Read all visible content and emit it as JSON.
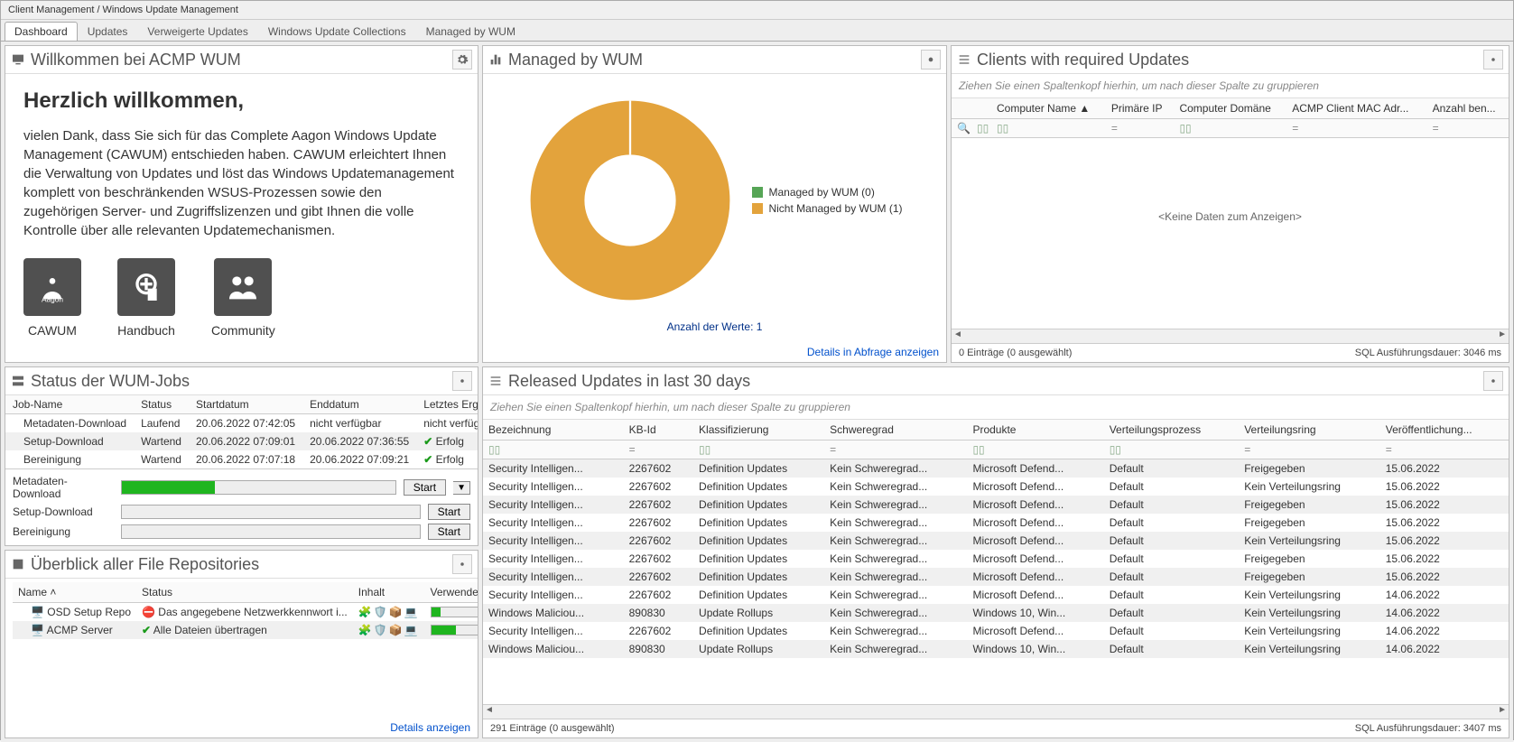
{
  "breadcrumb": "Client Management / Windows Update Management",
  "tabs": [
    "Dashboard",
    "Updates",
    "Verweigerte Updates",
    "Windows Update Collections",
    "Managed by WUM"
  ],
  "active_tab": 0,
  "welcome": {
    "panel_title": "Willkommen bei ACMP WUM",
    "heading": "Herzlich willkommen,",
    "paragraph": "vielen Dank, dass Sie sich für das Complete Aagon Windows Update Management (CAWUM) entschieden haben. CAWUM erleichtert Ihnen die Verwaltung von Updates und löst das Windows Updatemanagement komplett von beschränkenden WSUS-Prozessen sowie den zugehörigen Server- und Zugriffslizenzen und gibt Ihnen die volle Kontrolle über alle relevanten Updatemechanismen.",
    "cards": [
      {
        "label": "CAWUM",
        "icon": "package-icon"
      },
      {
        "label": "Handbuch",
        "icon": "book-icon"
      },
      {
        "label": "Community",
        "icon": "people-icon"
      }
    ]
  },
  "managed": {
    "panel_title": "Managed by WUM",
    "legend": [
      {
        "color": "#56a556",
        "label": "Managed by WUM (0)",
        "value": 0
      },
      {
        "color": "#e3a33c",
        "label": "Nicht Managed by WUM (1)",
        "value": 1
      }
    ],
    "caption": "Anzahl der Werte: 1",
    "details_link": "Details in Abfrage anzeigen"
  },
  "chart_data": {
    "type": "pie",
    "title": "Managed by WUM",
    "categories": [
      "Managed by WUM",
      "Nicht Managed by WUM"
    ],
    "values": [
      0,
      1
    ],
    "colors": [
      "#56a556",
      "#e3a33c"
    ]
  },
  "clients": {
    "panel_title": "Clients with required Updates",
    "group_hint": "Ziehen Sie einen Spaltenkopf hierhin, um nach dieser Spalte zu gruppieren",
    "columns": [
      "",
      "",
      "Computer Name ▲",
      "Primäre IP",
      "Computer Domäne",
      "ACMP Client MAC Adr...",
      "Anzahl ben..."
    ],
    "nodata": "<Keine Daten zum Anzeigen>",
    "status_left": "0 Einträge (0 ausgewählt)",
    "status_right": "SQL Ausführungsdauer: 3046 ms"
  },
  "jobs": {
    "panel_title": "Status der WUM-Jobs",
    "columns": [
      "Job-Name",
      "Status",
      "Startdatum",
      "Enddatum",
      "Letztes Ergebnis"
    ],
    "rows": [
      {
        "name": "Metadaten-Download",
        "status": "Laufend",
        "start": "20.06.2022 07:42:05",
        "end": "nicht verfügbar",
        "result": "nicht verfügbar",
        "ok": false
      },
      {
        "name": "Setup-Download",
        "status": "Wartend",
        "start": "20.06.2022 07:09:01",
        "end": "20.06.2022 07:36:55",
        "result": "Erfolg",
        "ok": true
      },
      {
        "name": "Bereinigung",
        "status": "Wartend",
        "start": "20.06.2022 07:07:18",
        "end": "20.06.2022 07:09:21",
        "result": "Erfolg",
        "ok": true
      }
    ],
    "progress": [
      {
        "label": "Metadaten-Download",
        "pct": 34,
        "start": "Start",
        "dropdown": true
      },
      {
        "label": "Setup-Download",
        "pct": 0,
        "start": "Start"
      },
      {
        "label": "Bereinigung",
        "pct": 0,
        "start": "Start"
      }
    ]
  },
  "repos": {
    "panel_title": "Überblick aller File Repositories",
    "columns": [
      "Name ˄",
      "Status",
      "Inhalt",
      "Verwendeter Speicher"
    ],
    "rows": [
      {
        "name": "OSD Setup Repo",
        "status": "Das angegebene Netzwerkkennwort i...",
        "status_icon": "error",
        "storage_pct": 10
      },
      {
        "name": "ACMP Server",
        "status": "Alle Dateien übertragen",
        "status_icon": "ok",
        "storage_pct": 25
      }
    ],
    "details_link": "Details anzeigen"
  },
  "released": {
    "panel_title": "Released Updates in last 30 days",
    "group_hint": "Ziehen Sie einen Spaltenkopf hierhin, um nach dieser Spalte zu gruppieren",
    "columns": [
      "Bezeichnung",
      "KB-Id",
      "Klassifizierung",
      "Schweregrad",
      "Produkte",
      "Verteilungsprozess",
      "Verteilungsring",
      "Veröffentlichung..."
    ],
    "rows": [
      {
        "c": [
          "Security Intelligen...",
          "2267602",
          "Definition Updates",
          "Kein Schweregrad...",
          "Microsoft Defend...",
          "Default",
          "Freigegeben",
          "15.06.2022"
        ]
      },
      {
        "c": [
          "Security Intelligen...",
          "2267602",
          "Definition Updates",
          "Kein Schweregrad...",
          "Microsoft Defend...",
          "Default",
          "Kein Verteilungsring",
          "15.06.2022"
        ]
      },
      {
        "c": [
          "Security Intelligen...",
          "2267602",
          "Definition Updates",
          "Kein Schweregrad...",
          "Microsoft Defend...",
          "Default",
          "Freigegeben",
          "15.06.2022"
        ]
      },
      {
        "c": [
          "Security Intelligen...",
          "2267602",
          "Definition Updates",
          "Kein Schweregrad...",
          "Microsoft Defend...",
          "Default",
          "Freigegeben",
          "15.06.2022"
        ]
      },
      {
        "c": [
          "Security Intelligen...",
          "2267602",
          "Definition Updates",
          "Kein Schweregrad...",
          "Microsoft Defend...",
          "Default",
          "Kein Verteilungsring",
          "15.06.2022"
        ]
      },
      {
        "c": [
          "Security Intelligen...",
          "2267602",
          "Definition Updates",
          "Kein Schweregrad...",
          "Microsoft Defend...",
          "Default",
          "Freigegeben",
          "15.06.2022"
        ]
      },
      {
        "c": [
          "Security Intelligen...",
          "2267602",
          "Definition Updates",
          "Kein Schweregrad...",
          "Microsoft Defend...",
          "Default",
          "Freigegeben",
          "15.06.2022"
        ]
      },
      {
        "c": [
          "Security Intelligen...",
          "2267602",
          "Definition Updates",
          "Kein Schweregrad...",
          "Microsoft Defend...",
          "Default",
          "Kein Verteilungsring",
          "14.06.2022"
        ]
      },
      {
        "c": [
          "Windows Maliciou...",
          "890830",
          "Update Rollups",
          "Kein Schweregrad...",
          "Windows 10, Win...",
          "Default",
          "Kein Verteilungsring",
          "14.06.2022"
        ]
      },
      {
        "c": [
          "Security Intelligen...",
          "2267602",
          "Definition Updates",
          "Kein Schweregrad...",
          "Microsoft Defend...",
          "Default",
          "Kein Verteilungsring",
          "14.06.2022"
        ]
      },
      {
        "c": [
          "Windows Maliciou...",
          "890830",
          "Update Rollups",
          "Kein Schweregrad...",
          "Windows 10, Win...",
          "Default",
          "Kein Verteilungsring",
          "14.06.2022"
        ]
      }
    ],
    "status_left": "291 Einträge (0 ausgewählt)",
    "status_right": "SQL Ausführungsdauer: 3407 ms"
  }
}
